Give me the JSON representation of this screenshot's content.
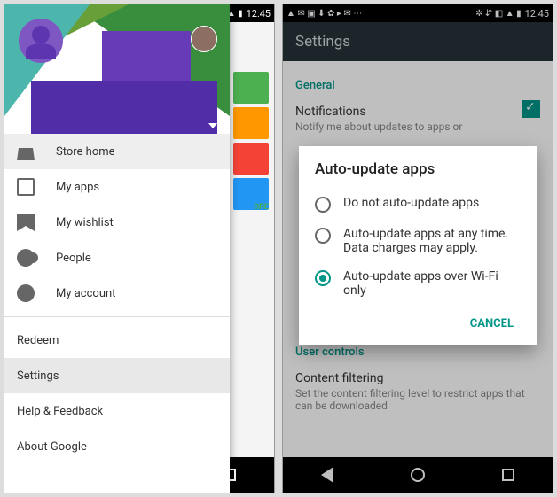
{
  "status": {
    "time": "12:45"
  },
  "left": {
    "drawer": {
      "items": [
        {
          "label": "Store home",
          "icon": "store",
          "selected": true
        },
        {
          "label": "My apps",
          "icon": "apps"
        },
        {
          "label": "My wishlist",
          "icon": "wish"
        },
        {
          "label": "People",
          "icon": "people"
        },
        {
          "label": "My account",
          "icon": "acct"
        }
      ],
      "text_items": [
        {
          "label": "Redeem"
        },
        {
          "label": "Settings",
          "selected": true
        },
        {
          "label": "Help & Feedback"
        },
        {
          "label": "About Google"
        }
      ]
    },
    "badge": "ORE"
  },
  "right": {
    "appbar_title": "Settings",
    "sections": {
      "general": {
        "head": "General"
      },
      "notifications": {
        "title": "Notifications",
        "sub": "Notify me about updates to apps or"
      },
      "user_controls": {
        "head": "User controls"
      },
      "content_filtering": {
        "title": "Content filtering",
        "sub": "Set the content filtering level to restrict apps that can be downloaded"
      }
    },
    "dialog": {
      "title": "Auto-update apps",
      "options": [
        {
          "label": "Do not auto-update apps",
          "selected": false
        },
        {
          "label": "Auto-update apps at any time. Data charges may apply.",
          "selected": false
        },
        {
          "label": "Auto-update apps over Wi-Fi only",
          "selected": true
        }
      ],
      "cancel": "CANCEL"
    }
  }
}
